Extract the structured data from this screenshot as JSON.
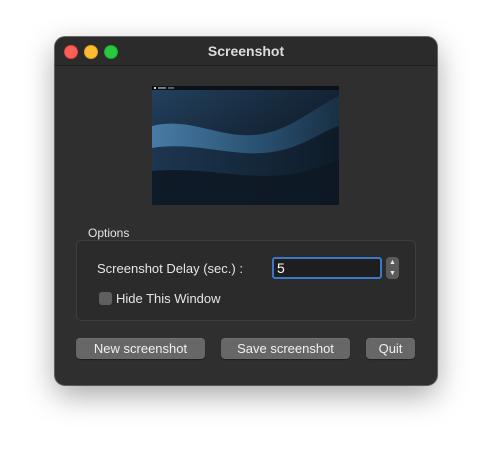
{
  "window": {
    "title": "Screenshot"
  },
  "preview": {
    "description_icon": "desktop-preview"
  },
  "options": {
    "group_label": "Options",
    "delay_label": "Screenshot Delay (sec.) :",
    "delay_value": "5",
    "stepper_up": "▲",
    "stepper_down": "▼",
    "hide_window_label": "Hide This Window",
    "hide_window_checked": false
  },
  "buttons": {
    "new_label": "New screenshot",
    "save_label": "Save screenshot",
    "quit_label": "Quit"
  },
  "colors": {
    "close": "#ff5f57",
    "minimize": "#febc2e",
    "maximize": "#28c840",
    "focus_ring": "#3a78c8"
  }
}
